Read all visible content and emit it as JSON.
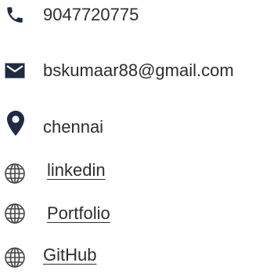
{
  "contacts": {
    "phone": {
      "icon": "phone-icon",
      "value": "9047720775"
    },
    "email": {
      "icon": "envelope-icon",
      "value": "bskumaar88@gmail.com"
    },
    "location": {
      "icon": "map-pin-icon",
      "value": "chennai"
    },
    "links": [
      {
        "icon": "globe-icon",
        "label": "linkedin"
      },
      {
        "icon": "globe-icon",
        "label": "Portfolio"
      },
      {
        "icon": "globe-icon",
        "label": "GitHub"
      }
    ]
  },
  "colors": {
    "icon_primary": "#1f2a44",
    "icon_globe": "#444444",
    "text": "#2d2d2d"
  }
}
